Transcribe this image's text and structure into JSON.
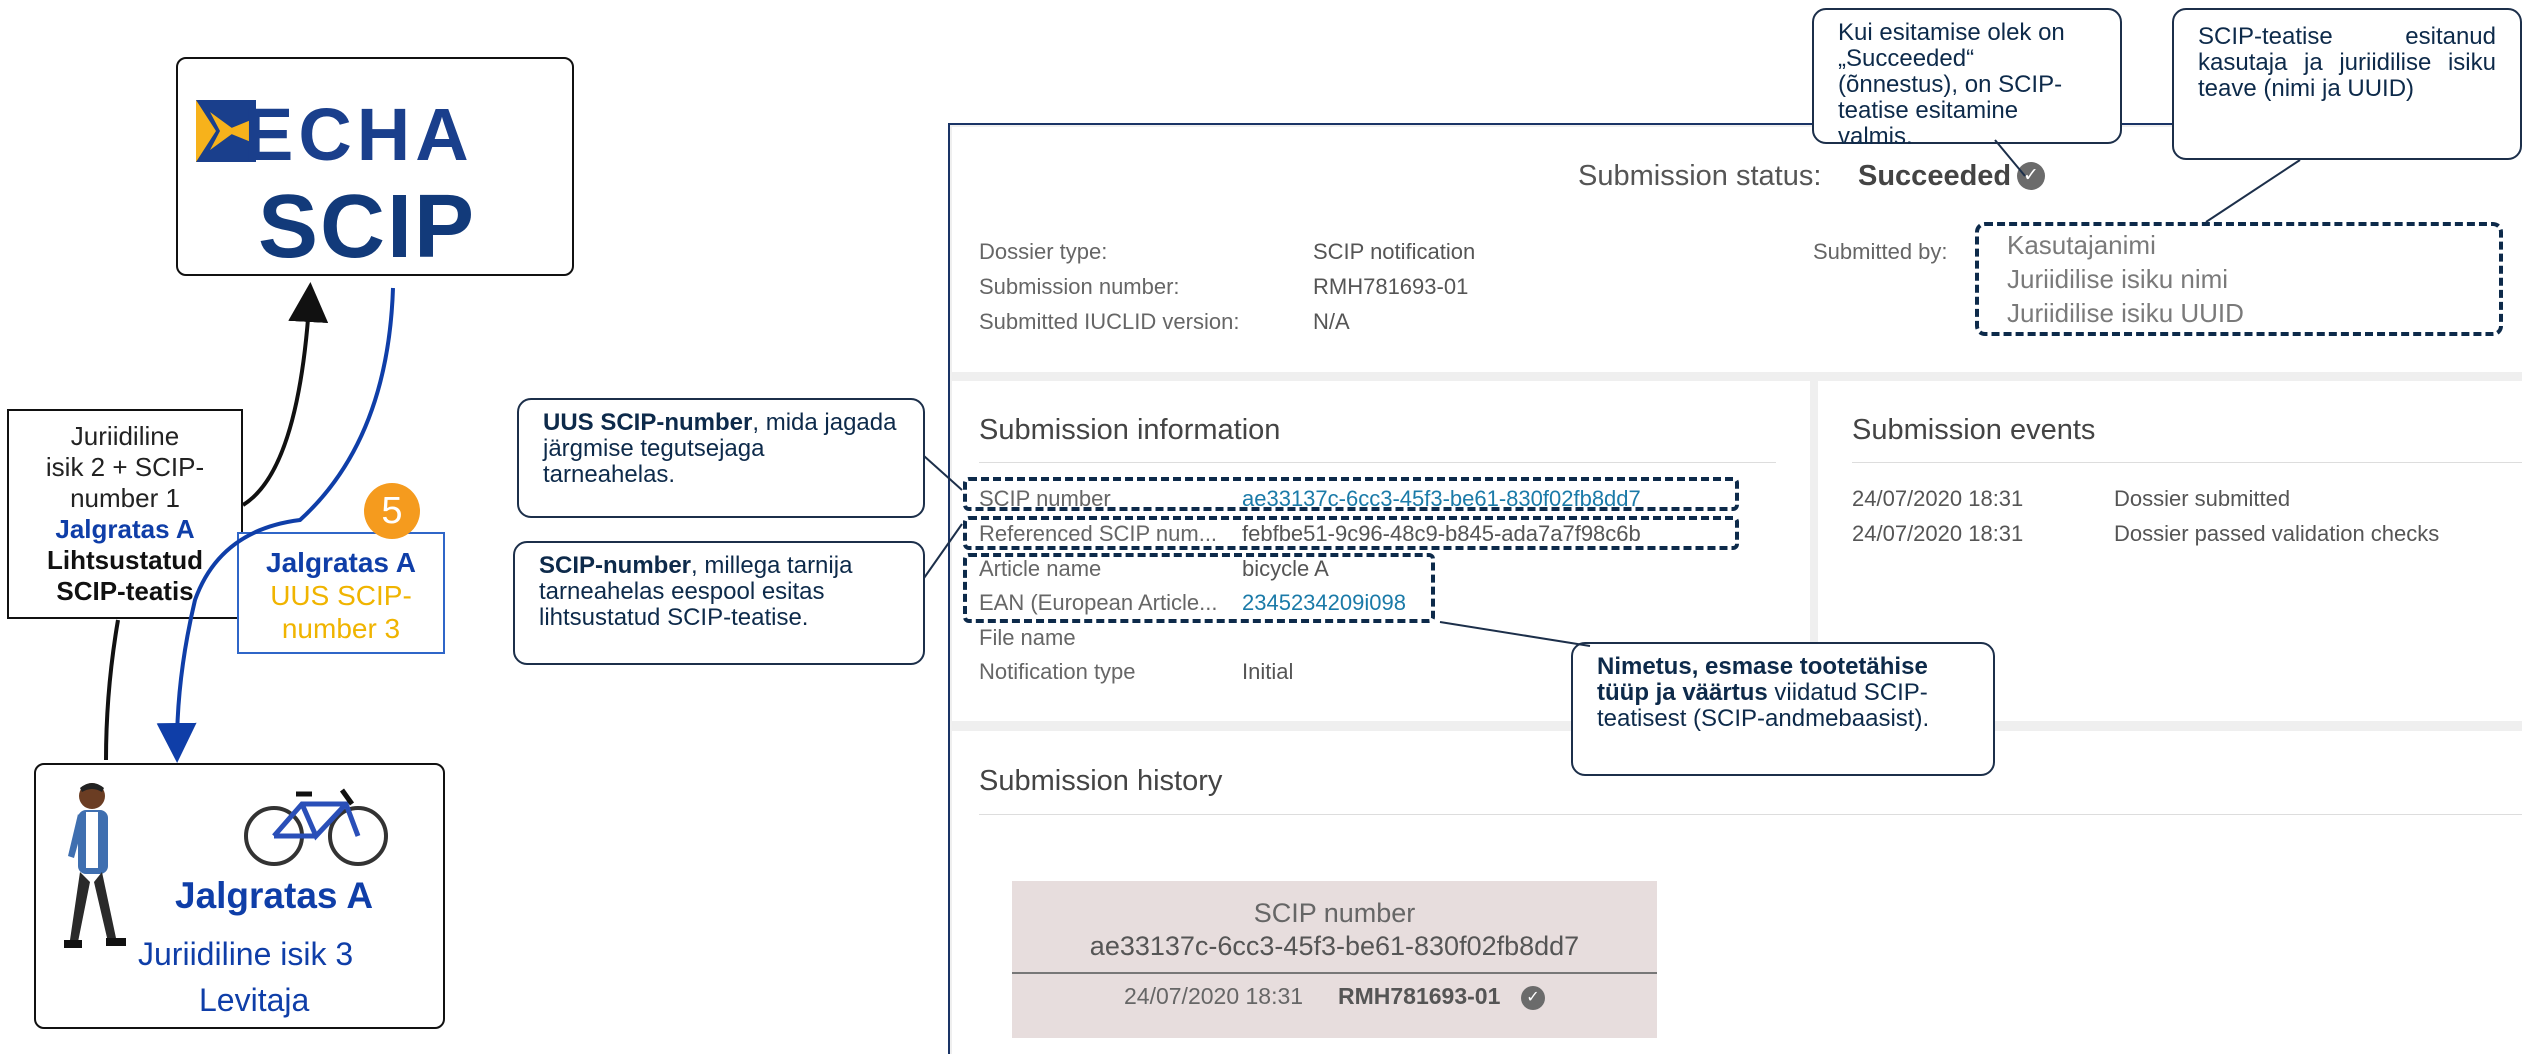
{
  "logo": {
    "top_word": "ECHA",
    "bottom_word": "SCIP"
  },
  "legal_entity_2_box": {
    "line1": "Juriidiline",
    "line2": "isik 2 + SCIP-",
    "line3": "number 1",
    "line4": "Jalgratas A",
    "line5": "Lihtsustatud",
    "line6": "SCIP-teatis"
  },
  "bicycle_box": {
    "title": "Jalgratas A",
    "line2": "UUS SCIP-",
    "line3": "number 3",
    "step_number": "5"
  },
  "distributor_box": {
    "title": "Jalgratas A",
    "line1": "Juriidiline isik 3",
    "line2": "Levitaja"
  },
  "callouts": {
    "new_scip_bold": "UUS SCIP-number",
    "new_scip_rest": ", mida jagada järgmise tegutsejaga tarneahelas.",
    "ref_scip_bold": "SCIP-number",
    "ref_scip_rest": ", millega tarnija tarneahelas eespool esitas lihtsustatud SCIP-teatise.",
    "article_bold": "Nimetus, esmase tootetähise tüüp ja väärtus",
    "article_rest": " viidatud SCIP-teatisest (SCIP-andmebaasist).",
    "status_note": "Kui esitamise olek on „Succeeded“ (õnnestus), on SCIP-teatise esitamine valmis.",
    "submitter_note": "SCIP-teatise esitanud kasutaja ja juriidilise isiku teave (nimi ja UUID)"
  },
  "status": {
    "label": "Submission status:",
    "value": "Succeeded"
  },
  "dossier": {
    "type_label": "Dossier type:",
    "type_value": "SCIP notification",
    "number_label": "Submission number:",
    "number_value": "RMH781693-01",
    "version_label": "Submitted IUCLID version:",
    "version_value": "N/A"
  },
  "submitted_by": {
    "label": "Submitted by:",
    "username": "Kasutajanimi",
    "entity_name": "Juriidilise isiku nimi",
    "entity_uuid": "Juriidilise isiku UUID"
  },
  "submission_information": {
    "title": "Submission information",
    "rows": [
      {
        "label": "SCIP number",
        "value": "ae33137c-6cc3-45f3-be61-830f02fb8dd7"
      },
      {
        "label": "Referenced SCIP num...",
        "value": "febfbe51-9c96-48c9-b845-ada7a7f98c6b"
      },
      {
        "label": "Article name",
        "value": "bicycle A"
      },
      {
        "label": "EAN (European Article...",
        "value": "2345234209i098"
      },
      {
        "label": "File name",
        "value": ""
      },
      {
        "label": "Notification type",
        "value": "Initial"
      }
    ]
  },
  "submission_events": {
    "title": "Submission events",
    "rows": [
      {
        "date": "24/07/2020 18:31",
        "event": "Dossier submitted"
      },
      {
        "date": "24/07/2020 18:31",
        "event": "Dossier passed validation checks"
      }
    ]
  },
  "submission_history": {
    "title": "Submission history",
    "item": {
      "label": "SCIP number",
      "scip": "ae33137c-6cc3-45f3-be61-830f02fb8dd7",
      "date": "24/07/2020 18:31",
      "number": "RMH781693-01"
    }
  },
  "icons": {
    "check": "check-circle-icon",
    "bicycle": "bicycle-icon",
    "person": "walking-person-icon"
  },
  "colors": {
    "echa_blue": "#1a3f8c",
    "badge_orange": "#f59b1e",
    "new_yellow": "#f0b400",
    "link": "#1a7aa8",
    "callout_border": "#0d2a4a"
  }
}
